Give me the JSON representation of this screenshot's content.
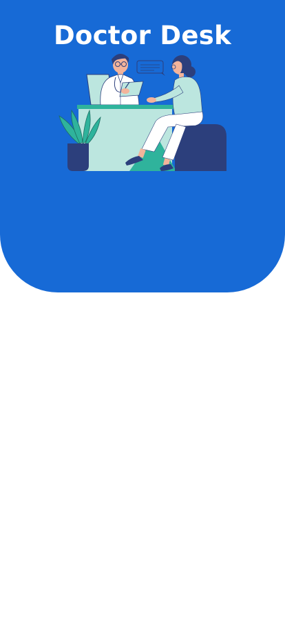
{
  "app": {
    "title": "Doctor Desk"
  },
  "hero": {
    "background_color": "#176ad6",
    "illustration": "doctor-patient-consultation-illustration"
  },
  "colors": {
    "primary": "#176ad6",
    "navy": "#2c3f7c",
    "mint": "#bce6df",
    "teal": "#2fb39c",
    "white": "#ffffff"
  }
}
